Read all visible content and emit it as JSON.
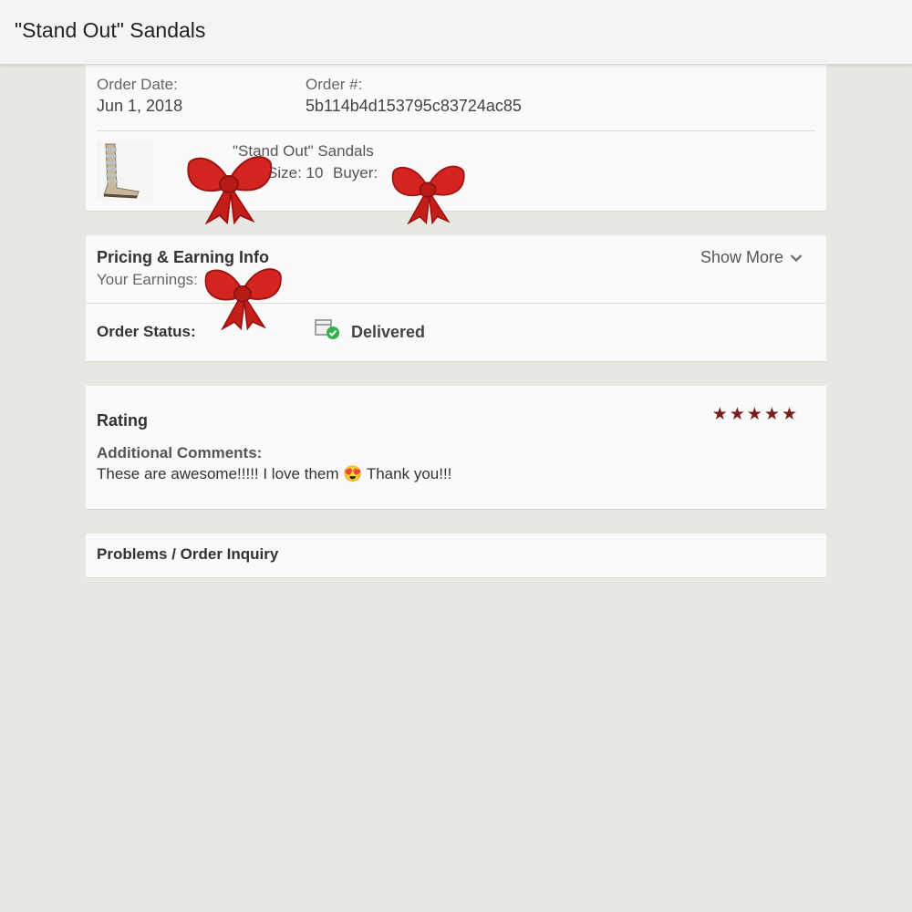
{
  "header": {
    "title": "\"Stand Out\" Sandals"
  },
  "order": {
    "date_label": "Order Date:",
    "date_value": "Jun 1, 2018",
    "number_label": "Order #:",
    "number_value": "5b114b4d153795c83724ac85",
    "item_title": "\"Stand Out\" Sandals",
    "size_text": "Size: 10",
    "buyer_label": "Buyer:",
    "thumbnail_icon": "sandal-image"
  },
  "pricing": {
    "title": "Pricing & Earning Info",
    "earnings_label": "Your Earnings:",
    "show_more": "Show More"
  },
  "status": {
    "label": "Order Status:",
    "value": "Delivered",
    "icon": "delivered-box-icon",
    "badge_color": "#2fb24a"
  },
  "rating": {
    "title": "Rating",
    "stars": 5,
    "comments_label": "Additional Comments:",
    "comment_text_1": "These are awesome!!!!! I love them",
    "comment_text_2": "Thank you!!!",
    "emoji": "😍",
    "star_color": "#7a1b1b"
  },
  "problems": {
    "title": "Problems / Order Inquiry"
  },
  "stickers": {
    "icon": "red-bow-sticker",
    "color": "#d3241f"
  }
}
